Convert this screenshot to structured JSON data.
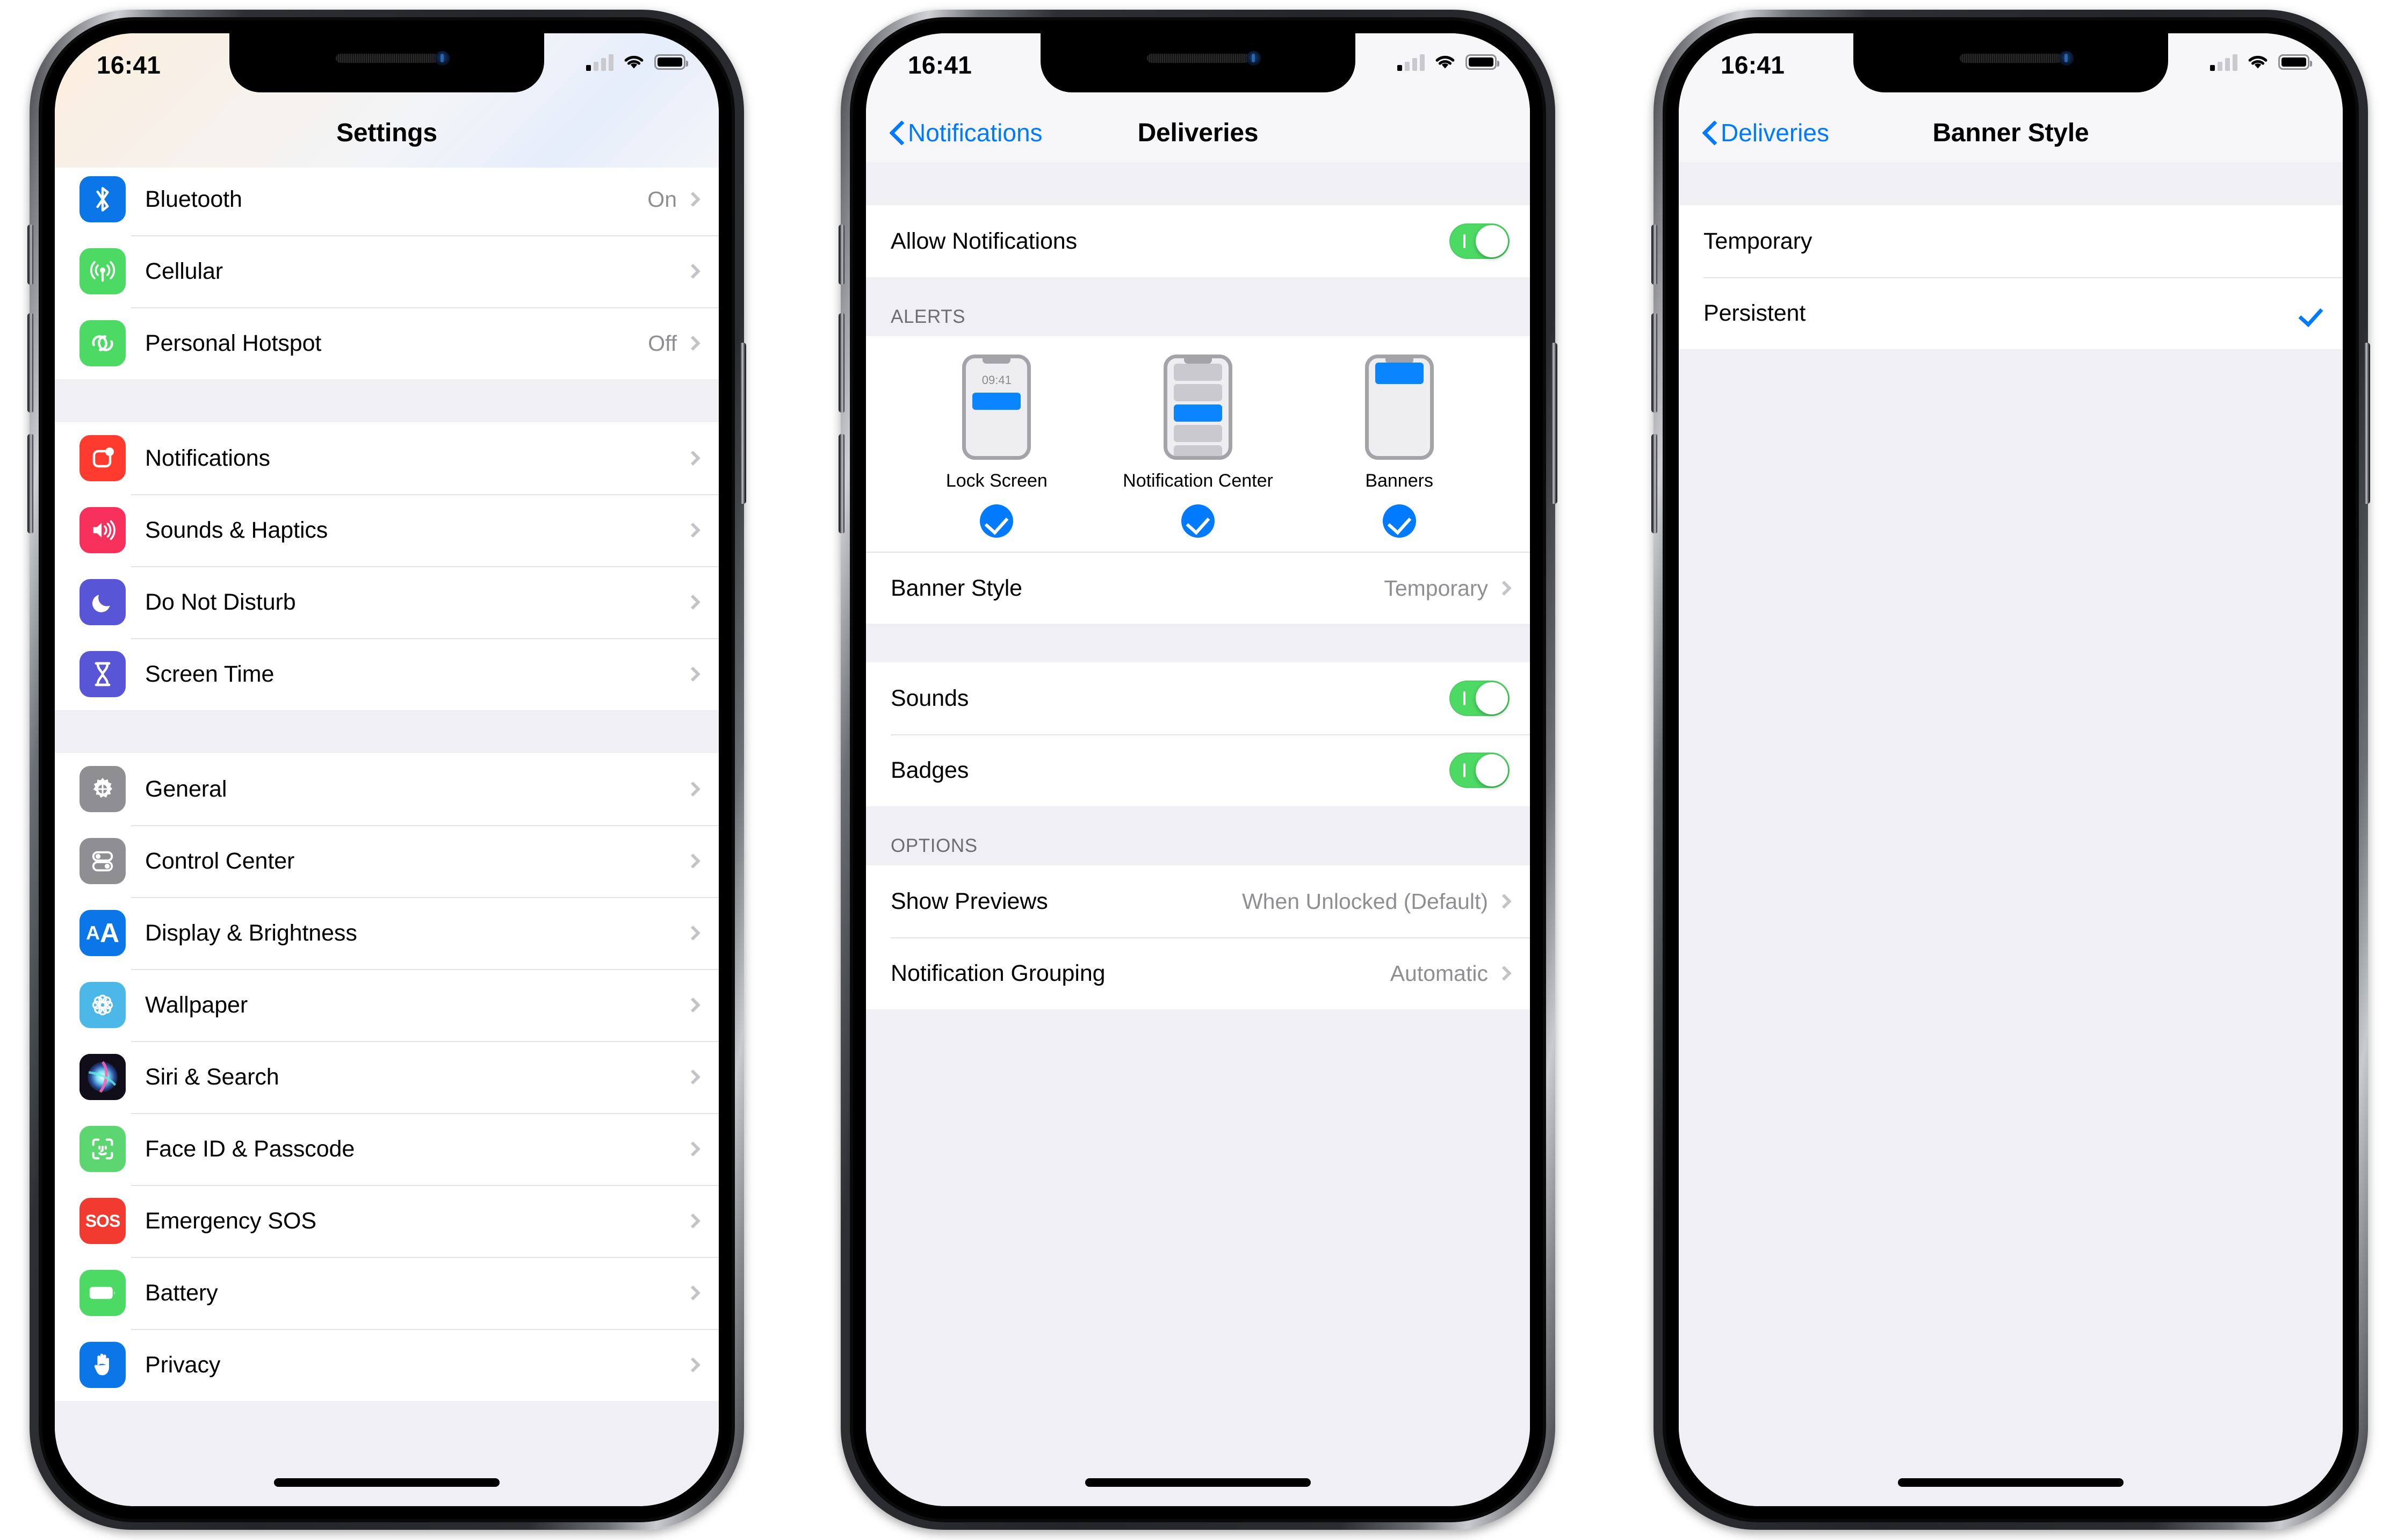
{
  "status_bar": {
    "time": "16:41",
    "signal_icon": "cellular-signal-icon",
    "wifi_icon": "wifi-icon",
    "battery_icon": "battery-icon"
  },
  "colors": {
    "accent_blue": "#007aff",
    "toggle_green": "#4cd964",
    "group_bg": "#efeff4",
    "separator": "#e3e3e6",
    "secondary_text": "#8e8e93"
  },
  "screen1": {
    "title": "Settings",
    "groups": [
      {
        "rows": [
          {
            "label": "Bluetooth",
            "value": "On",
            "icon": "bluetooth-icon",
            "icon_color": "#0a76e8",
            "chevron": true
          },
          {
            "label": "Cellular",
            "value": "",
            "icon": "cellular-icon",
            "icon_color": "#4cd964",
            "chevron": true
          },
          {
            "label": "Personal Hotspot",
            "value": "Off",
            "icon": "hotspot-icon",
            "icon_color": "#4cd964",
            "chevron": true
          }
        ]
      },
      {
        "rows": [
          {
            "label": "Notifications",
            "value": "",
            "icon": "notifications-icon",
            "icon_color": "#ff3b30",
            "chevron": true
          },
          {
            "label": "Sounds & Haptics",
            "value": "",
            "icon": "sounds-icon",
            "icon_color": "#f8315c",
            "chevron": true
          },
          {
            "label": "Do Not Disturb",
            "value": "",
            "icon": "moon-icon",
            "icon_color": "#5856d6",
            "chevron": true
          },
          {
            "label": "Screen Time",
            "value": "",
            "icon": "hourglass-icon",
            "icon_color": "#5856d6",
            "chevron": true
          }
        ]
      },
      {
        "rows": [
          {
            "label": "General",
            "value": "",
            "icon": "gear-icon",
            "icon_color": "#8e8e93",
            "chevron": true
          },
          {
            "label": "Control Center",
            "value": "",
            "icon": "sliders-icon",
            "icon_color": "#8e8e93",
            "chevron": true
          },
          {
            "label": "Display & Brightness",
            "value": "",
            "icon": "text-size-icon",
            "icon_color": "#0a76e8",
            "chevron": true
          },
          {
            "label": "Wallpaper",
            "value": "",
            "icon": "flower-icon",
            "icon_color": "#4cb8e8",
            "chevron": true
          },
          {
            "label": "Siri & Search",
            "value": "",
            "icon": "siri-icon",
            "icon_color": "#16131f",
            "chevron": true
          },
          {
            "label": "Face ID & Passcode",
            "value": "",
            "icon": "face-id-icon",
            "icon_color": "#5cd670",
            "chevron": true
          },
          {
            "label": "Emergency SOS",
            "value": "",
            "icon": "sos-icon",
            "icon_color": "#f23b30",
            "chevron": true
          },
          {
            "label": "Battery",
            "value": "",
            "icon": "battery-icon",
            "icon_color": "#4cd964",
            "chevron": true
          },
          {
            "label": "Privacy",
            "value": "",
            "icon": "hand-icon",
            "icon_color": "#0a76e8",
            "chevron": true
          }
        ]
      }
    ]
  },
  "screen2": {
    "back_label": "Notifications",
    "title": "Deliveries",
    "allow_row": {
      "label": "Allow Notifications",
      "toggle": "on"
    },
    "alerts_header": "ALERTS",
    "alerts": [
      {
        "name": "Lock Screen",
        "checked": true,
        "mock": "lock-screen",
        "mock_time": "09:41"
      },
      {
        "name": "Notification Center",
        "checked": true,
        "mock": "notification-center"
      },
      {
        "name": "Banners",
        "checked": true,
        "mock": "banners"
      }
    ],
    "banner_style_row": {
      "label": "Banner Style",
      "value": "Temporary"
    },
    "switch_rows": [
      {
        "label": "Sounds",
        "toggle": "on"
      },
      {
        "label": "Badges",
        "toggle": "on"
      }
    ],
    "options_header": "OPTIONS",
    "option_rows": [
      {
        "label": "Show Previews",
        "value": "When Unlocked (Default)"
      },
      {
        "label": "Notification Grouping",
        "value": "Automatic"
      }
    ]
  },
  "screen3": {
    "back_label": "Deliveries",
    "title": "Banner Style",
    "options": [
      {
        "label": "Temporary",
        "selected": false
      },
      {
        "label": "Persistent",
        "selected": true
      }
    ]
  }
}
